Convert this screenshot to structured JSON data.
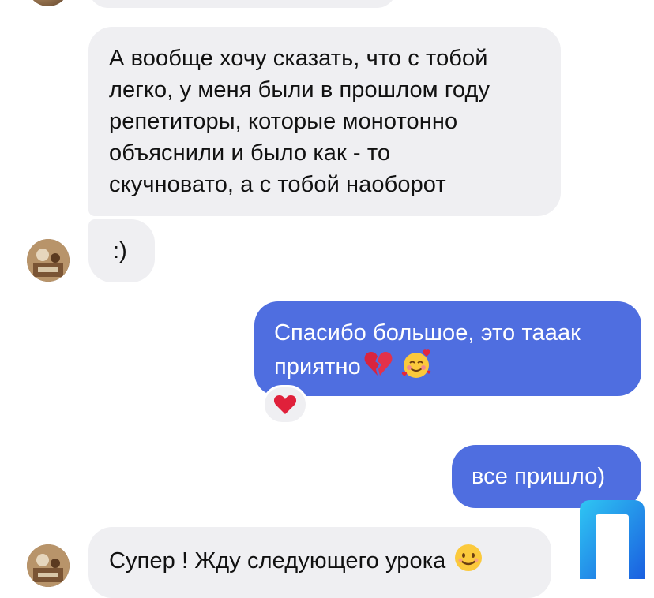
{
  "messages": {
    "m1": {
      "lines": [
        "А вообще хочу сказать, что с тобой",
        "легко, у меня были в прошлом году",
        "репетиторы, которые монотонно",
        "объяснили и было как - то",
        "скучновато, а с тобой наоборот"
      ]
    },
    "m2": {
      "text": ":)"
    },
    "m3": {
      "line1": "Спасибо большое, это тааак",
      "line2": "приятно",
      "emojis": [
        "broken-heart-icon",
        "smiling-face-with-hearts-icon"
      ],
      "reaction": "heart-icon"
    },
    "m4": {
      "text": "все пришло)"
    },
    "m5": {
      "text": "Супер ! Жду следующего урока",
      "emoji": "smiling-face-icon"
    }
  },
  "colors": {
    "incoming_bubble": "#efeff2",
    "outgoing_bubble": "#4f6ee0",
    "watermark": "#1e8be8"
  }
}
